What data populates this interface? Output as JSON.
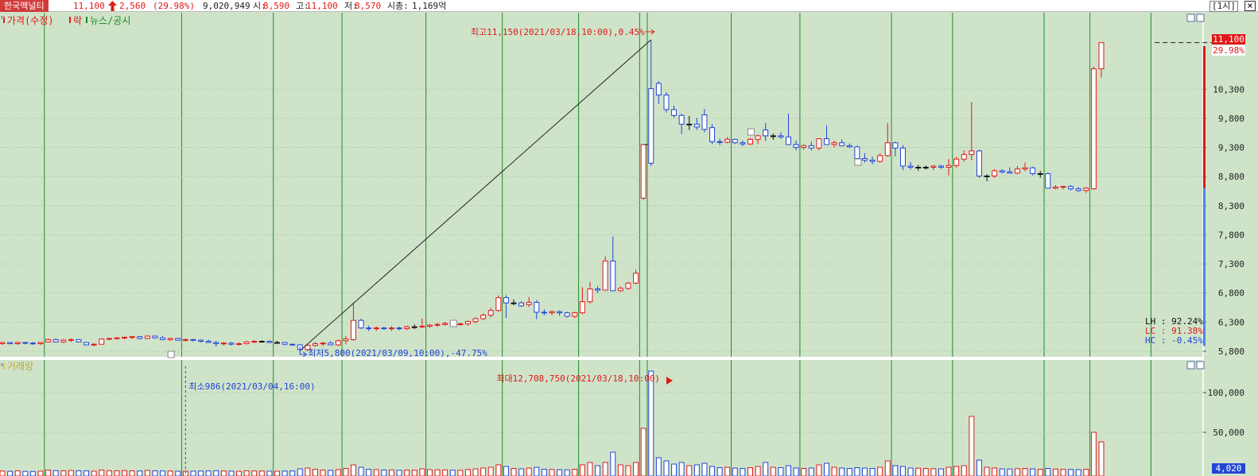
{
  "header": {
    "stock_name": "한국맥널티",
    "price": "11,100",
    "change_arrow": "up-arrow-icon",
    "change": "2,560",
    "change_pct": "(29.98%)",
    "volume": "9,020,949",
    "open_label": "시:",
    "open_value": "8,590",
    "high_label": "고:",
    "high_value": "11,100",
    "low_label": "저:",
    "low_value": "8,570",
    "mcap_label": "시총:",
    "mcap_value": "1,169억",
    "timeframe": "1시",
    "close_icon": "close-icon"
  },
  "price_panel": {
    "legend": [
      {
        "label": "가격(수정)",
        "color": "#e11919"
      },
      {
        "label": "락",
        "color": "#e11919"
      },
      {
        "label": "뉴스/공시",
        "color": "#1a8a1a"
      }
    ],
    "high_annotation": "최고11,150(2021/03/18,10:00),0.45%",
    "low_annotation": "최저5,800(2021/03/09,10:00),-47.75%",
    "current_price_label": "11,100",
    "current_pct_label": "29.98%",
    "stats": [
      {
        "label": "LH : 92.24%",
        "color": "#111111"
      },
      {
        "label": "LC : 91.38%",
        "color": "#e11919"
      },
      {
        "label": "HC : -0.45%",
        "color": "#2146d6"
      }
    ],
    "y_ticks": [
      "10,300",
      "9,800",
      "9,300",
      "8,800",
      "8,300",
      "7,800",
      "7,300",
      "6,800",
      "6,300",
      "5,800"
    ]
  },
  "volume_panel": {
    "legend": "거래량",
    "max_annotation": "최대12,708,750(2021/03/18,10:00)",
    "min_annotation": "최소986(2021/03/04,16:00)",
    "y_ticks": [
      "100,000",
      "50,000"
    ],
    "current_volume_label": "4,020"
  },
  "colors": {
    "up": "#e11919",
    "down": "#2146d6",
    "grid": "#1f8f2a",
    "background": "#cfe3c9"
  },
  "chart_data": {
    "type": "candlestick",
    "title": "",
    "price_range": [
      5700,
      11300
    ],
    "volume_range": [
      0,
      140000
    ],
    "candles": [
      [
        5930,
        5960,
        5910,
        5950,
        1200
      ],
      [
        5950,
        5960,
        5920,
        5930,
        900
      ],
      [
        5930,
        5960,
        5910,
        5950,
        1500
      ],
      [
        5950,
        5960,
        5920,
        5940,
        800
      ],
      [
        5940,
        5960,
        5910,
        5930,
        700
      ],
      [
        5930,
        5960,
        5910,
        5950,
        1100
      ],
      [
        5960,
        6020,
        5950,
        6000,
        2500
      ],
      [
        6000,
        6020,
        5950,
        5960,
        1800
      ],
      [
        5960,
        6010,
        5940,
        5990,
        1500
      ],
      [
        5990,
        6020,
        5960,
        6000,
        1900
      ],
      [
        6000,
        6010,
        5950,
        5960,
        1600
      ],
      [
        5950,
        5960,
        5900,
        5910,
        1400
      ],
      [
        5910,
        5940,
        5890,
        5920,
        1000
      ],
      [
        5920,
        6020,
        5920,
        6010,
        2600
      ],
      [
        6010,
        6030,
        5990,
        6020,
        1700
      ],
      [
        6020,
        6040,
        6000,
        6030,
        1500
      ],
      [
        6030,
        6050,
        6000,
        6040,
        1800
      ],
      [
        6040,
        6060,
        6010,
        6050,
        1500
      ],
      [
        6050,
        6060,
        6000,
        6020,
        1300
      ],
      [
        6020,
        6070,
        6010,
        6060,
        2000
      ],
      [
        6060,
        6070,
        6020,
        6030,
        1500
      ],
      [
        6030,
        6060,
        5990,
        6000,
        1400
      ],
      [
        6000,
        6030,
        5980,
        6020,
        1200
      ],
      [
        6020,
        6030,
        5980,
        5990,
        1000
      ],
      [
        5990,
        6020,
        5970,
        6000,
        986
      ],
      [
        6000,
        6010,
        5970,
        5990,
        1100
      ],
      [
        5990,
        6000,
        5950,
        5970,
        1200
      ],
      [
        5970,
        6000,
        5950,
        5950,
        1400
      ],
      [
        5950,
        5980,
        5880,
        5930,
        1600
      ],
      [
        5930,
        5960,
        5900,
        5940,
        1300
      ],
      [
        5940,
        5960,
        5900,
        5920,
        1100
      ],
      [
        5920,
        5950,
        5900,
        5930,
        900
      ],
      [
        5930,
        5980,
        5920,
        5960,
        1500
      ],
      [
        5960,
        5990,
        5940,
        5970,
        1300
      ],
      [
        5970,
        5990,
        5950,
        5970,
        1200
      ],
      [
        5970,
        5990,
        5940,
        5950,
        1100
      ],
      [
        5950,
        5980,
        5930,
        5950,
        1000
      ],
      [
        5950,
        5960,
        5900,
        5920,
        1200
      ],
      [
        5920,
        5930,
        5900,
        5910,
        1300
      ],
      [
        5910,
        5920,
        5810,
        5830,
        4000
      ],
      [
        5830,
        5920,
        5800,
        5900,
        5000
      ],
      [
        5900,
        5960,
        5880,
        5930,
        3500
      ],
      [
        5930,
        5960,
        5890,
        5940,
        2500
      ],
      [
        5940,
        5970,
        5900,
        5910,
        2200
      ],
      [
        5910,
        6000,
        5890,
        5980,
        3000
      ],
      [
        5980,
        6060,
        5920,
        6010,
        4500
      ],
      [
        6000,
        6640,
        5980,
        6330,
        9000
      ],
      [
        6330,
        6360,
        6180,
        6200,
        6000
      ],
      [
        6200,
        6240,
        6150,
        6190,
        3500
      ],
      [
        6190,
        6230,
        6150,
        6200,
        3000
      ],
      [
        6200,
        6220,
        6170,
        6190,
        2500
      ],
      [
        6190,
        6230,
        6150,
        6200,
        2600
      ],
      [
        6200,
        6220,
        6160,
        6190,
        2200
      ],
      [
        6190,
        6240,
        6160,
        6220,
        2400
      ],
      [
        6220,
        6260,
        6180,
        6220,
        2300
      ],
      [
        6220,
        6360,
        6200,
        6230,
        4000
      ],
      [
        6230,
        6260,
        6200,
        6250,
        3000
      ],
      [
        6250,
        6290,
        6220,
        6260,
        2800
      ],
      [
        6260,
        6300,
        6240,
        6280,
        2600
      ],
      [
        6280,
        6300,
        6240,
        6260,
        2400
      ],
      [
        6260,
        6290,
        6240,
        6270,
        2200
      ],
      [
        6270,
        6330,
        6240,
        6310,
        3200
      ],
      [
        6310,
        6380,
        6280,
        6360,
        4000
      ],
      [
        6360,
        6450,
        6330,
        6420,
        5000
      ],
      [
        6420,
        6550,
        6380,
        6500,
        6000
      ],
      [
        6500,
        6760,
        6480,
        6720,
        9000
      ],
      [
        6720,
        6760,
        6370,
        6630,
        7000
      ],
      [
        6630,
        6690,
        6590,
        6630,
        4500
      ],
      [
        6630,
        6660,
        6560,
        6580,
        4000
      ],
      [
        6600,
        6730,
        6560,
        6640,
        5000
      ],
      [
        6640,
        6680,
        6350,
        6470,
        6000
      ],
      [
        6470,
        6520,
        6420,
        6460,
        3500
      ],
      [
        6460,
        6500,
        6420,
        6480,
        3200
      ],
      [
        6480,
        6500,
        6410,
        6460,
        3000
      ],
      [
        6460,
        6480,
        6380,
        6400,
        2800
      ],
      [
        6400,
        6480,
        6370,
        6460,
        3500
      ],
      [
        6460,
        6900,
        6440,
        6650,
        9000
      ],
      [
        6650,
        6990,
        6620,
        6870,
        12000
      ],
      [
        6870,
        6920,
        6800,
        6850,
        8000
      ],
      [
        6850,
        7430,
        6840,
        7350,
        12000
      ],
      [
        7350,
        7770,
        6830,
        6840,
        25000
      ],
      [
        6840,
        6910,
        6820,
        6880,
        9000
      ],
      [
        6880,
        6990,
        6860,
        6970,
        8000
      ],
      [
        6970,
        7200,
        6950,
        7140,
        12000
      ],
      [
        8430,
        9350,
        8400,
        9350,
        55000
      ],
      [
        10310,
        11150,
        8980,
        9030,
        127000
      ],
      [
        10400,
        10440,
        10050,
        10200,
        18000
      ],
      [
        10200,
        10250,
        9900,
        9950,
        14000
      ],
      [
        9950,
        10020,
        9810,
        9850,
        10000
      ],
      [
        9850,
        9880,
        9530,
        9700,
        12000
      ],
      [
        9700,
        9840,
        9600,
        9700,
        8000
      ],
      [
        9700,
        9810,
        9600,
        9650,
        9000
      ],
      [
        9860,
        9960,
        9560,
        9610,
        11000
      ],
      [
        9640,
        9700,
        9360,
        9400,
        7000
      ],
      [
        9400,
        9450,
        9340,
        9390,
        5500
      ],
      [
        9390,
        9480,
        9370,
        9440,
        6000
      ],
      [
        9440,
        9450,
        9360,
        9380,
        5000
      ],
      [
        9380,
        9420,
        9320,
        9360,
        4500
      ],
      [
        9360,
        9460,
        9340,
        9440,
        5500
      ],
      [
        9440,
        9520,
        9360,
        9500,
        7000
      ],
      [
        9600,
        9720,
        9410,
        9500,
        12000
      ],
      [
        9500,
        9540,
        9430,
        9500,
        6000
      ],
      [
        9500,
        9560,
        9450,
        9480,
        5500
      ],
      [
        9480,
        9880,
        9450,
        9350,
        8000
      ],
      [
        9350,
        9420,
        9250,
        9300,
        5000
      ],
      [
        9300,
        9350,
        9260,
        9330,
        4500
      ],
      [
        9330,
        9400,
        9250,
        9290,
        5000
      ],
      [
        9290,
        9460,
        9250,
        9450,
        9000
      ],
      [
        9450,
        9680,
        9380,
        9350,
        11000
      ],
      [
        9350,
        9420,
        9300,
        9380,
        6000
      ],
      [
        9380,
        9440,
        9320,
        9330,
        5000
      ],
      [
        9330,
        9370,
        9290,
        9310,
        4500
      ],
      [
        9310,
        9330,
        9090,
        9110,
        5500
      ],
      [
        9110,
        9200,
        9040,
        9080,
        5000
      ],
      [
        9080,
        9140,
        9010,
        9060,
        4500
      ],
      [
        9060,
        9200,
        9040,
        9160,
        6000
      ],
      [
        9160,
        9720,
        9140,
        9380,
        14000
      ],
      [
        9380,
        9400,
        9150,
        9290,
        8000
      ],
      [
        9290,
        9340,
        8910,
        8980,
        7000
      ],
      [
        8980,
        9050,
        8920,
        8960,
        5000
      ],
      [
        8960,
        9000,
        8900,
        8960,
        4800
      ],
      [
        8960,
        8990,
        8920,
        8960,
        4500
      ],
      [
        8960,
        9000,
        8910,
        8980,
        4200
      ],
      [
        8980,
        9000,
        8930,
        8960,
        4000
      ],
      [
        8960,
        9100,
        8820,
        8990,
        6000
      ],
      [
        8990,
        9140,
        8950,
        9100,
        7000
      ],
      [
        9100,
        9250,
        9050,
        9180,
        8000
      ],
      [
        9180,
        10080,
        9080,
        9240,
        70000
      ],
      [
        9240,
        9260,
        8780,
        8810,
        15000
      ],
      [
        8810,
        8840,
        8720,
        8810,
        6000
      ],
      [
        8810,
        8930,
        8780,
        8900,
        5000
      ],
      [
        8900,
        8920,
        8850,
        8880,
        4000
      ],
      [
        8880,
        8960,
        8850,
        8860,
        3800
      ],
      [
        8860,
        8980,
        8840,
        8930,
        4200
      ],
      [
        8930,
        9040,
        8890,
        8950,
        4500
      ],
      [
        8950,
        8970,
        8820,
        8850,
        4000
      ],
      [
        8850,
        8900,
        8780,
        8850,
        3500
      ],
      [
        8850,
        8870,
        8600,
        8600,
        4500
      ],
      [
        8600,
        8650,
        8580,
        8620,
        3800
      ],
      [
        8620,
        8640,
        8580,
        8630,
        3500
      ],
      [
        8630,
        8650,
        8560,
        8590,
        3200
      ],
      [
        8590,
        8620,
        8540,
        8560,
        3000
      ],
      [
        8560,
        8620,
        8520,
        8600,
        3500
      ],
      [
        8590,
        10690,
        8570,
        10650,
        50000
      ],
      [
        10650,
        11100,
        10500,
        11100,
        38000
      ]
    ],
    "dividers_candle_index": [
      6,
      24,
      36,
      45,
      56,
      66,
      76,
      84,
      85,
      96,
      105,
      117,
      125,
      137,
      143,
      151
    ],
    "high_line": {
      "from_candle": 39,
      "to_candle": 85
    },
    "dash_levels": [
      {
        "from_candle": 84,
        "to_candle": 85,
        "price": 9350
      },
      {
        "from_candle": 151,
        "to_candle": 155,
        "price": 11100
      }
    ]
  }
}
